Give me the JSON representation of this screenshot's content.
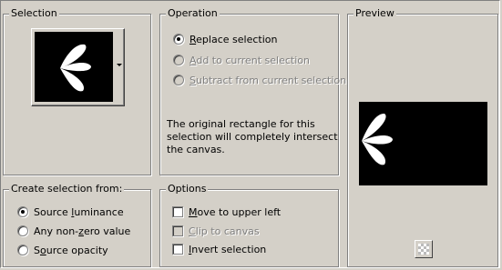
{
  "selection": {
    "title": "Selection",
    "thumbnail_icon": "petal-fan-shape-icon"
  },
  "operation": {
    "title": "Operation",
    "options": [
      {
        "pre": "",
        "acc": "R",
        "post": "eplace selection",
        "checked": true,
        "enabled": true
      },
      {
        "pre": "",
        "acc": "A",
        "post": "dd to current selection",
        "checked": false,
        "enabled": false
      },
      {
        "pre": "",
        "acc": "S",
        "post": "ubtract from current selection",
        "checked": false,
        "enabled": false
      }
    ],
    "info_text": "The original rectangle for this selection will completely intersect the canvas."
  },
  "preview": {
    "title": "Preview",
    "button_icon": "transparency-checker-icon"
  },
  "create_from": {
    "title": "Create selection from:",
    "options": [
      {
        "pre": "Source ",
        "acc": "l",
        "post": "uminance",
        "checked": true
      },
      {
        "pre": "Any non-",
        "acc": "z",
        "post": "ero value",
        "checked": false
      },
      {
        "pre": "S",
        "acc": "o",
        "post": "urce opacity",
        "checked": false
      }
    ]
  },
  "options": {
    "title": "Options",
    "items": [
      {
        "pre": "",
        "acc": "M",
        "post": "ove to upper left",
        "checked": false,
        "enabled": true
      },
      {
        "pre": "",
        "acc": "C",
        "post": "lip to canvas",
        "checked": false,
        "enabled": false
      },
      {
        "pre": "",
        "acc": "I",
        "post": "nvert selection",
        "checked": false,
        "enabled": true
      }
    ]
  },
  "colors": {
    "face": "#d4d0c8",
    "shadow": "#808080",
    "highlight": "#ffffff"
  }
}
